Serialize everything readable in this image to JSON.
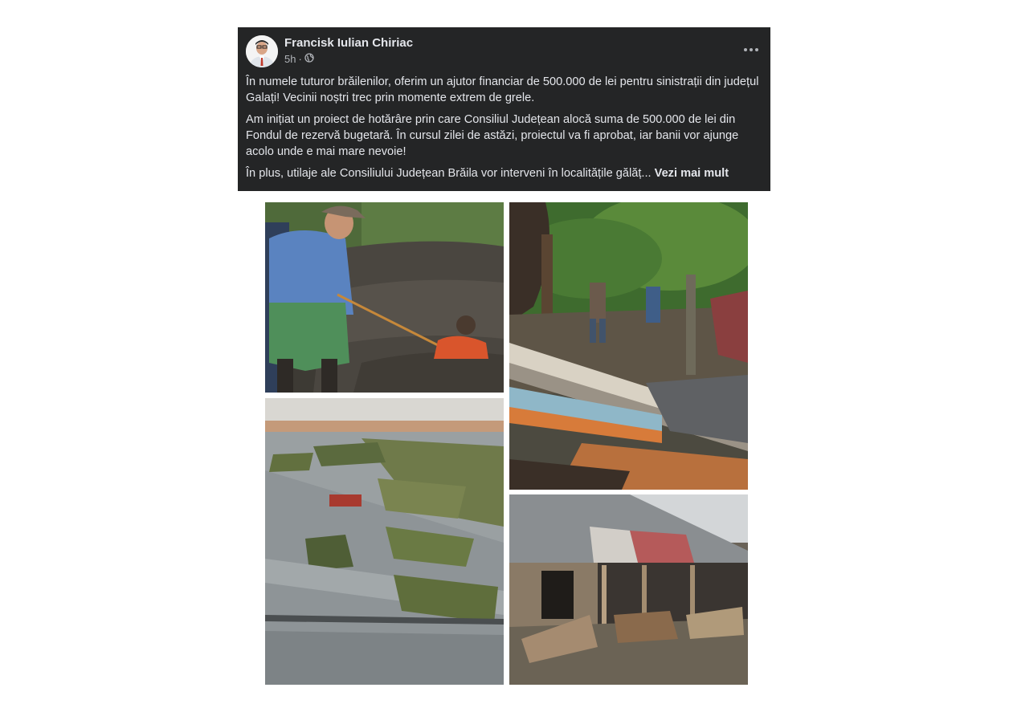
{
  "post": {
    "author": "Francisk Iulian Chiriac",
    "time": "5h",
    "separator": "·",
    "privacy_icon": "globe-icon",
    "menu_icon": "more-horizontal-icon",
    "paragraphs": [
      "În numele tuturor brăilenilor, oferim un ajutor financiar de 500.000 de lei pentru sinistrații din județul Galați! Vecinii noștri trec prin momente extrem de grele.",
      "Am inițiat un proiect de hotărâre prin care Consiliul Județean alocă suma de 500.000 de lei din Fondul de rezervă bugetară. În cursul zilei de astăzi, proiectul va fi aprobat, iar banii vor ajunge acolo unde e mai mare nevoie!",
      "În plus, utilaje ale Consiliului Județean Brăila vor interveni în localitățile gălăț..."
    ],
    "see_more": "Vezi mai mult"
  },
  "colors": {
    "post_bg": "#242526",
    "text": "#e4e6eb",
    "secondary_text": "#b0b3b8"
  },
  "gallery": {
    "photos": [
      {
        "name": "photo-flood-rescue"
      },
      {
        "name": "photo-debris-yard"
      },
      {
        "name": "photo-aerial-flood"
      },
      {
        "name": "photo-damaged-shed"
      }
    ]
  }
}
